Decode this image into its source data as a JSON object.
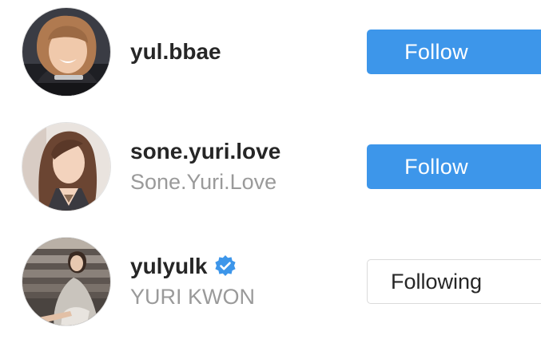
{
  "suggestions": [
    {
      "username": "yul.bbae",
      "full_name": "",
      "verified": false,
      "button_label": "Follow",
      "button_state": "follow",
      "avatar_icon": "profile-photo-icon"
    },
    {
      "username": "sone.yuri.love",
      "full_name": "Sone.Yuri.Love",
      "verified": false,
      "button_label": "Follow",
      "button_state": "follow",
      "avatar_icon": "profile-photo-icon"
    },
    {
      "username": "yulyulk",
      "full_name": "YURI KWON",
      "verified": true,
      "verified_icon": "verified-badge-icon",
      "button_label": "Following",
      "button_state": "following",
      "avatar_icon": "profile-photo-icon"
    }
  ],
  "colors": {
    "follow_button": "#3d96ea",
    "verified_badge": "#3d96ea",
    "username_text": "#262626",
    "fullname_text": "#9a9a9a",
    "following_border": "#dbdbdb"
  }
}
